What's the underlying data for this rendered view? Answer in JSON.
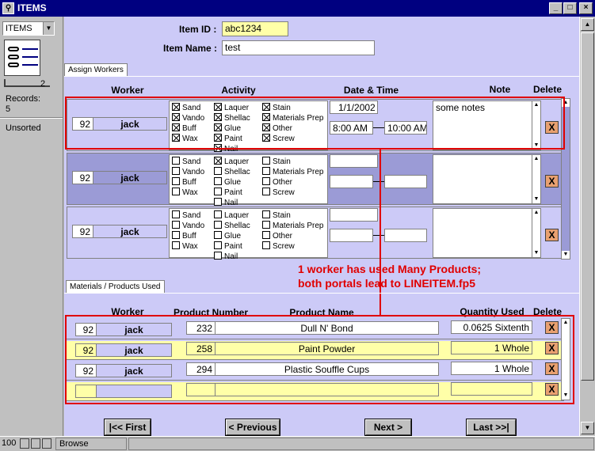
{
  "window": {
    "title": "ITEMS"
  },
  "status_area": {
    "layout": "ITEMS",
    "book_page": "2",
    "records_label": "Records:",
    "records_count": "5",
    "sort_status": "Unsorted"
  },
  "form": {
    "item_id_label": "Item ID :",
    "item_id": "abc1234",
    "item_name_label": "Item Name :",
    "item_name": "test"
  },
  "workers_portal": {
    "tab": "Assign Workers",
    "headers": {
      "worker": "Worker",
      "activity": "Activity",
      "date_time": "Date & Time",
      "note": "Note",
      "delete": "Delete"
    },
    "activity_labels": [
      "Sand",
      "Laquer",
      "Stain",
      "Vando",
      "Shellac",
      "Materials Prep",
      "Buff",
      "Glue",
      "Other",
      "Wax",
      "Paint",
      "Screw",
      "Nail"
    ],
    "rows": [
      {
        "id": "92",
        "name": "jack",
        "checked": [
          "Sand",
          "Laquer",
          "Stain",
          "Vando",
          "Shellac",
          "Materials Prep",
          "Buff",
          "Glue",
          "Other",
          "Wax",
          "Paint",
          "Screw",
          "Nail"
        ],
        "date": "1/1/2002",
        "start": "8:00 AM",
        "end": "10:00 AM",
        "note": "some notes"
      },
      {
        "id": "92",
        "name": "jack",
        "checked": [
          "Laquer"
        ],
        "date": "",
        "start": "",
        "end": "",
        "note": ""
      },
      {
        "id": "92",
        "name": "jack",
        "checked": [],
        "date": "",
        "start": "",
        "end": "",
        "note": ""
      }
    ],
    "delete_glyph": "X"
  },
  "annotation": {
    "line1": "1 worker has used Many Products;",
    "line2": "both portals lead to LINEITEM.fp5"
  },
  "materials_portal": {
    "tab": "Materials / Products Used",
    "headers": {
      "worker": "Worker",
      "product_number": "Product Number",
      "product_name": "Product Name",
      "quantity": "Quantity Used",
      "delete": "Delete"
    },
    "rows": [
      {
        "id": "92",
        "name": "jack",
        "number": "232",
        "product": "Dull N' Bond",
        "qty": "0.0625 Sixtenth"
      },
      {
        "id": "92",
        "name": "jack",
        "number": "258",
        "product": "Paint Powder",
        "qty": "1 Whole"
      },
      {
        "id": "92",
        "name": "jack",
        "number": "294",
        "product": "Plastic Souffle Cups",
        "qty": "1 Whole"
      },
      {
        "id": "",
        "name": "",
        "number": "",
        "product": "",
        "qty": ""
      }
    ],
    "delete_glyph": "X"
  },
  "nav": {
    "first": "|<< First",
    "previous": "< Previous",
    "next": "Next >",
    "last": "Last >>|"
  },
  "bottom": {
    "zoom": "100",
    "mode": "Browse"
  },
  "colors": {
    "layout_bg": "#cccaf7",
    "row_alt_bg": "#9b9bd6",
    "field_yellow": "#ffffa8",
    "annotation_red": "#e00000",
    "delete_orange": "#e8a070"
  }
}
